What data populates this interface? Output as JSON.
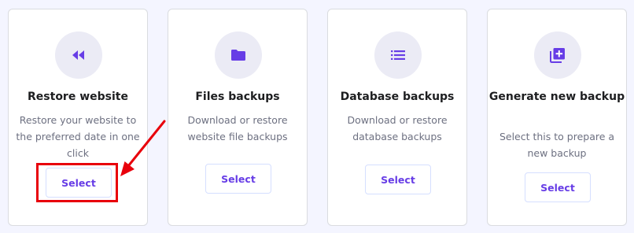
{
  "cards": [
    {
      "icon": "rewind-icon",
      "title": "Restore website",
      "description": "Restore your website to the preferred date in one click",
      "button": "Select"
    },
    {
      "icon": "folder-icon",
      "title": "Files backups",
      "description": "Download or restore website file backups",
      "button": "Select"
    },
    {
      "icon": "list-icon",
      "title": "Database backups",
      "description": "Download or restore database backups",
      "button": "Select"
    },
    {
      "icon": "add-copy-icon",
      "title": "Generate new backup",
      "description": "Select this to prepare a new backup",
      "button": "Select"
    }
  ],
  "colors": {
    "accent": "#673de6",
    "icon_bg": "#ebebf5",
    "annotation": "#e8000b"
  }
}
